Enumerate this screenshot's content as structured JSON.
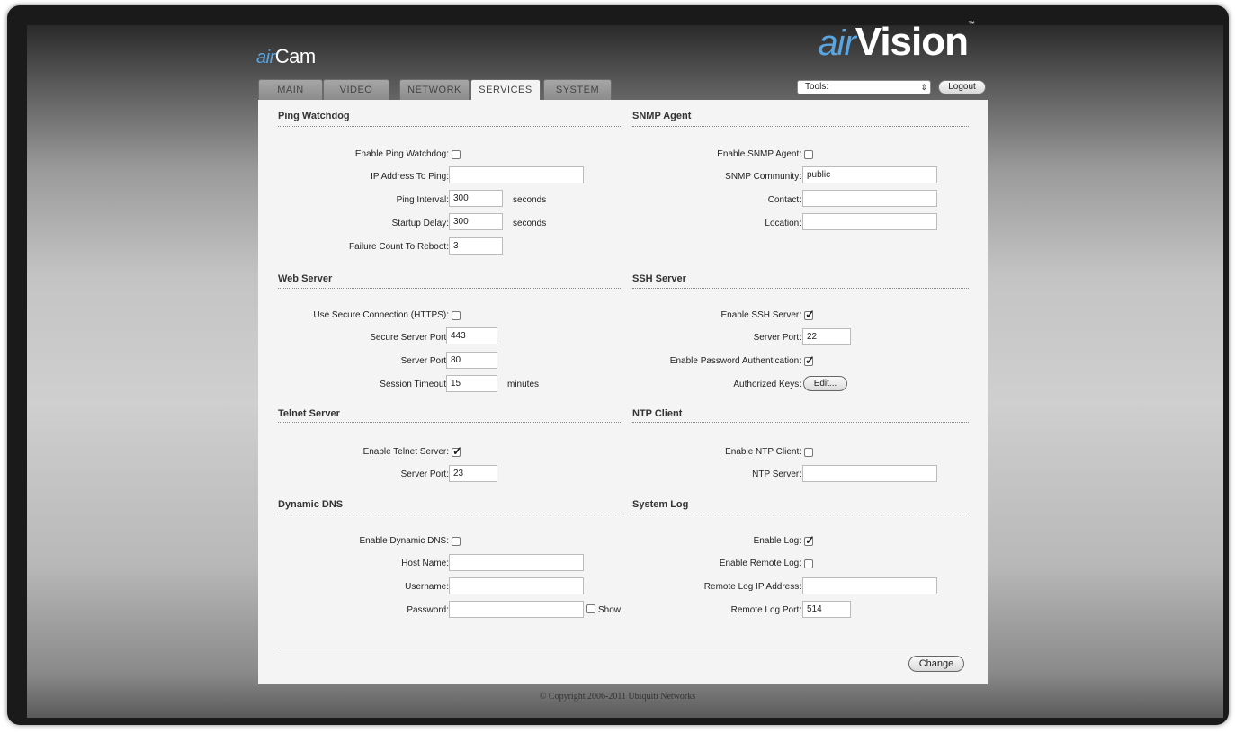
{
  "brand": {
    "left_prefix": "air",
    "left_name": "Cam",
    "right_prefix": "air",
    "right_name": "Vision",
    "right_tm": "™"
  },
  "tabs": [
    {
      "label": "MAIN"
    },
    {
      "label": "VIDEO"
    },
    {
      "label": "NETWORK"
    },
    {
      "label": "SERVICES",
      "active": true
    },
    {
      "label": "SYSTEM"
    }
  ],
  "header": {
    "tools_select": "Tools:",
    "logout_label": "Logout"
  },
  "ping_watchdog": {
    "title": "Ping Watchdog",
    "enable_label": "Enable Ping Watchdog:",
    "enable_checked": false,
    "ip_label": "IP Address To Ping:",
    "ip_value": "",
    "interval_label": "Ping Interval:",
    "interval_value": "300",
    "interval_unit": "seconds",
    "startup_label": "Startup Delay:",
    "startup_value": "300",
    "startup_unit": "seconds",
    "failure_label": "Failure Count To Reboot:",
    "failure_value": "3"
  },
  "snmp": {
    "title": "SNMP Agent",
    "enable_label": "Enable SNMP Agent:",
    "enable_checked": false,
    "community_label": "SNMP Community:",
    "community_value": "public",
    "contact_label": "Contact:",
    "contact_value": "",
    "location_label": "Location:",
    "location_value": ""
  },
  "web_server": {
    "title": "Web Server",
    "https_label": "Use Secure Connection (HTTPS):",
    "https_checked": false,
    "secure_port_label": "Secure Server Port:",
    "secure_port_value": "443",
    "port_label": "Server Port:",
    "port_value": "80",
    "timeout_label": "Session Timeout:",
    "timeout_value": "15",
    "timeout_unit": "minutes"
  },
  "ssh": {
    "title": "SSH Server",
    "enable_label": "Enable SSH Server:",
    "enable_checked": true,
    "port_label": "Server Port:",
    "port_value": "22",
    "pwauth_label": "Enable Password Authentication:",
    "pwauth_checked": true,
    "keys_label": "Authorized Keys:",
    "keys_button": "Edit..."
  },
  "telnet": {
    "title": "Telnet Server",
    "enable_label": "Enable Telnet Server:",
    "enable_checked": true,
    "port_label": "Server Port:",
    "port_value": "23"
  },
  "ntp": {
    "title": "NTP Client",
    "enable_label": "Enable NTP Client:",
    "enable_checked": false,
    "server_label": "NTP Server:",
    "server_value": ""
  },
  "ddns": {
    "title": "Dynamic DNS",
    "enable_label": "Enable Dynamic DNS:",
    "enable_checked": false,
    "host_label": "Host Name:",
    "host_value": "",
    "user_label": "Username:",
    "user_value": "",
    "pass_label": "Password:",
    "pass_value": "",
    "show_label": "Show",
    "show_checked": false
  },
  "syslog": {
    "title": "System Log",
    "enable_label": "Enable Log:",
    "enable_checked": true,
    "remote_label": "Enable Remote Log:",
    "remote_checked": false,
    "ip_label": "Remote Log IP Address:",
    "ip_value": "",
    "port_label": "Remote Log Port:",
    "port_value": "514"
  },
  "actions": {
    "change_label": "Change"
  },
  "footer": {
    "copyright": "© Copyright 2006-2011 Ubiquiti Networks"
  },
  "check_glyph": "✓"
}
